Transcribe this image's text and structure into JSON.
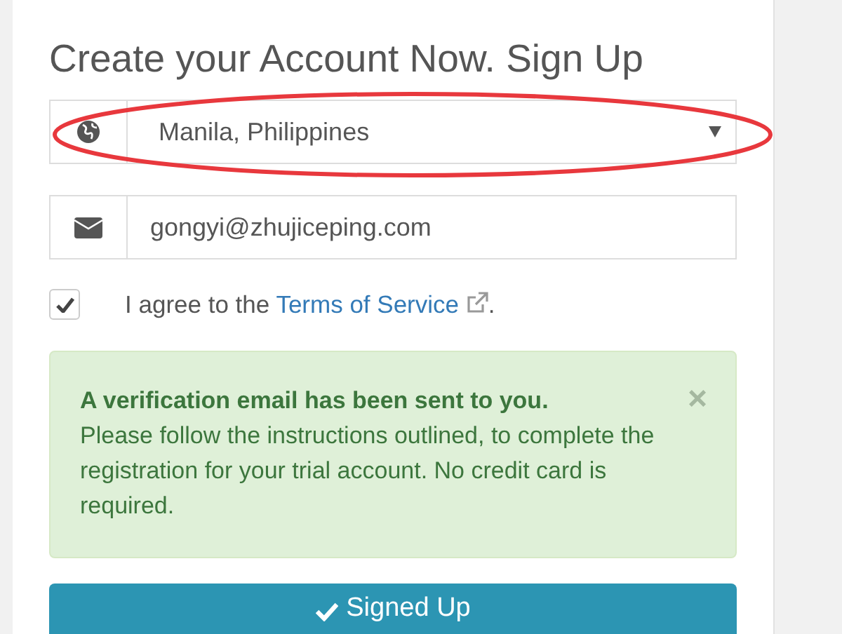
{
  "form": {
    "title": "Create your Account Now. Sign Up",
    "location": {
      "value": "Manila, Philippines"
    },
    "email": {
      "value": "gongyi@zhujiceping.com"
    },
    "agree": {
      "checked": true,
      "text": "I agree to the ",
      "link": "Terms of Service",
      "after": "."
    },
    "alert": {
      "heading": "A verification email has been sent to you.",
      "body": "Please follow the instructions outlined, to complete the registration for your trial account. No credit card is required.",
      "close": "×"
    },
    "submit": {
      "label": "Signed Up"
    }
  }
}
